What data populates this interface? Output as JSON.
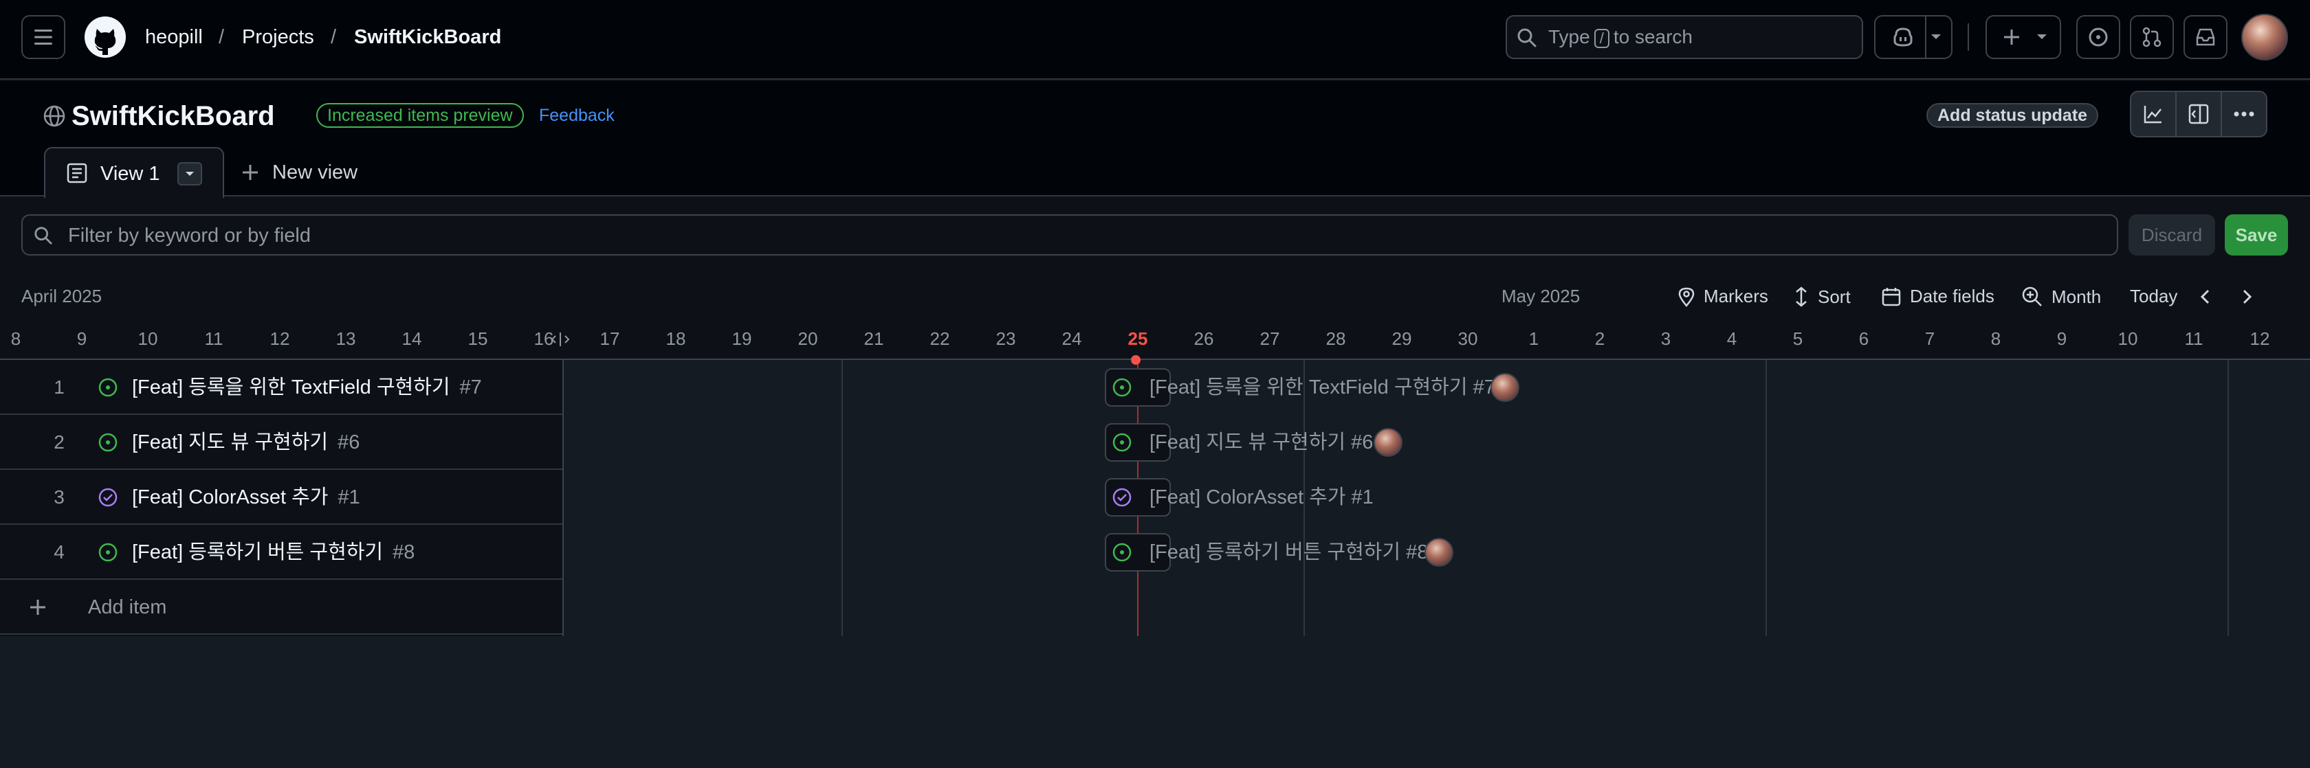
{
  "header": {
    "breadcrumb": [
      "heopill",
      "Projects",
      "SwiftKickBoard"
    ],
    "search_prefix": "Type",
    "search_key": "/",
    "search_suffix": "to search"
  },
  "project": {
    "title": "SwiftKickBoard",
    "badge": "Increased items preview",
    "feedback": "Feedback",
    "status_update": "Add status update",
    "tabs": [
      {
        "label": "View 1"
      }
    ],
    "new_view": "New view"
  },
  "filter": {
    "placeholder": "Filter by keyword or by field",
    "discard": "Discard",
    "save": "Save"
  },
  "timeline": {
    "month_left": "April 2025",
    "month_right": "May 2025",
    "controls": {
      "markers": "Markers",
      "sort": "Sort",
      "date_fields": "Date fields",
      "month": "Month",
      "today": "Today"
    },
    "days": [
      "8",
      "9",
      "10",
      "11",
      "12",
      "13",
      "14",
      "15",
      "16",
      "17",
      "18",
      "19",
      "20",
      "21",
      "22",
      "23",
      "24",
      "25",
      "26",
      "27",
      "28",
      "29",
      "30",
      "1",
      "2",
      "3",
      "4",
      "5",
      "6",
      "7",
      "8",
      "9",
      "10",
      "11",
      "12"
    ],
    "today_day": "25"
  },
  "items": [
    {
      "num": "1",
      "title": "[Feat] 등록을 위한 TextField 구현하기",
      "issue": "#7",
      "status": "open",
      "gantt_label": "[Feat] 등록을 위한 TextField 구현하기 #7",
      "assignee": true
    },
    {
      "num": "2",
      "title": "[Feat] 지도 뷰 구현하기",
      "issue": "#6",
      "status": "open",
      "gantt_label": "[Feat] 지도 뷰 구현하기 #6",
      "assignee": true
    },
    {
      "num": "3",
      "title": "[Feat] ColorAsset 추가",
      "issue": "#1",
      "status": "closed",
      "gantt_label": "[Feat] ColorAsset 추가 #1",
      "assignee": false
    },
    {
      "num": "4",
      "title": "[Feat] 등록하기 버튼 구현하기",
      "issue": "#8",
      "status": "open",
      "gantt_label": "[Feat] 등록하기 버튼 구현하기 #8",
      "assignee": true
    }
  ],
  "add_item": "Add item",
  "colors": {
    "open": "#3fb950",
    "closed": "#ab7df8",
    "today": "#f85149",
    "accent": "#4493f8"
  }
}
